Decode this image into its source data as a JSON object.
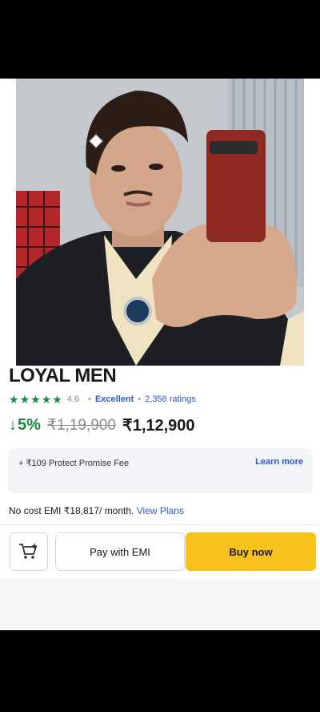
{
  "product": {
    "title": "LOYAL MEN",
    "rating": "4.6",
    "rating_label": "Excellent",
    "ratings_count": "2,358 ratings",
    "stars_count": 4.5,
    "star_color": "#148a3c"
  },
  "pricing": {
    "discount": "5%",
    "mrp": "₹1,19,900",
    "price": "₹1,12,900"
  },
  "fee": {
    "text": "+ ₹109 Protect Promise Fee",
    "link": "Learn more"
  },
  "emi": {
    "text": "No cost EMI ₹18,817/ month.",
    "link": "View Plans"
  },
  "actions": {
    "cart_icon": "add-to-cart-icon",
    "pay_emi": "Pay with EMI",
    "buy_now": "Buy now",
    "buy_color": "#f7c21b"
  }
}
